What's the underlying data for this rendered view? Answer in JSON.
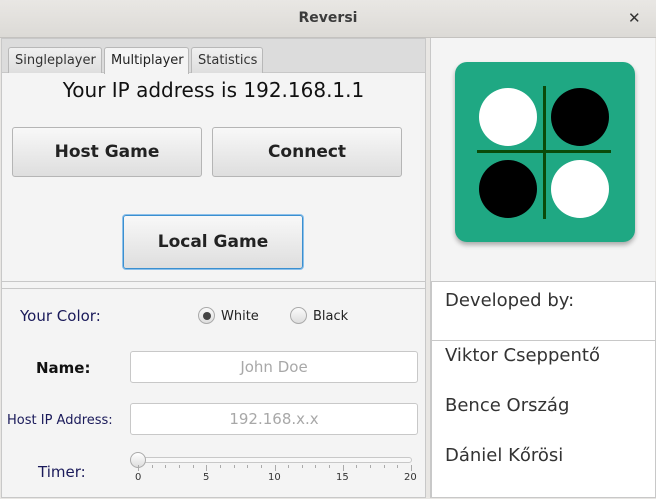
{
  "window": {
    "title": "Reversi",
    "close": "✕"
  },
  "tabs": [
    {
      "label": "Singleplayer"
    },
    {
      "label": "Multiplayer",
      "selected": true
    },
    {
      "label": "Statistics"
    }
  ],
  "multiplayer": {
    "ip_text": "Your IP address is 192.168.1.1",
    "host_button": "Host Game",
    "connect_button": "Connect",
    "local_button": "Local Game",
    "color_label": "Your Color:",
    "color_options": [
      "White",
      "Black"
    ],
    "color_selected": "White",
    "name_label": "Name:",
    "name_placeholder": "John Doe",
    "host_ip_label": "Host IP Address:",
    "host_ip_placeholder": "192.168.x.x",
    "timer_label": "Timer:",
    "timer_value": 0,
    "timer_ticks": [
      "0",
      "5",
      "10",
      "15",
      "20"
    ]
  },
  "about": {
    "developed_label": "Developed by:",
    "developers": [
      "Viktor Cseppentő",
      "Bence Ország",
      "Dániel Kőrösi"
    ]
  },
  "colors": {
    "logo": "#1fa883",
    "grid": "#0a4a0a"
  }
}
